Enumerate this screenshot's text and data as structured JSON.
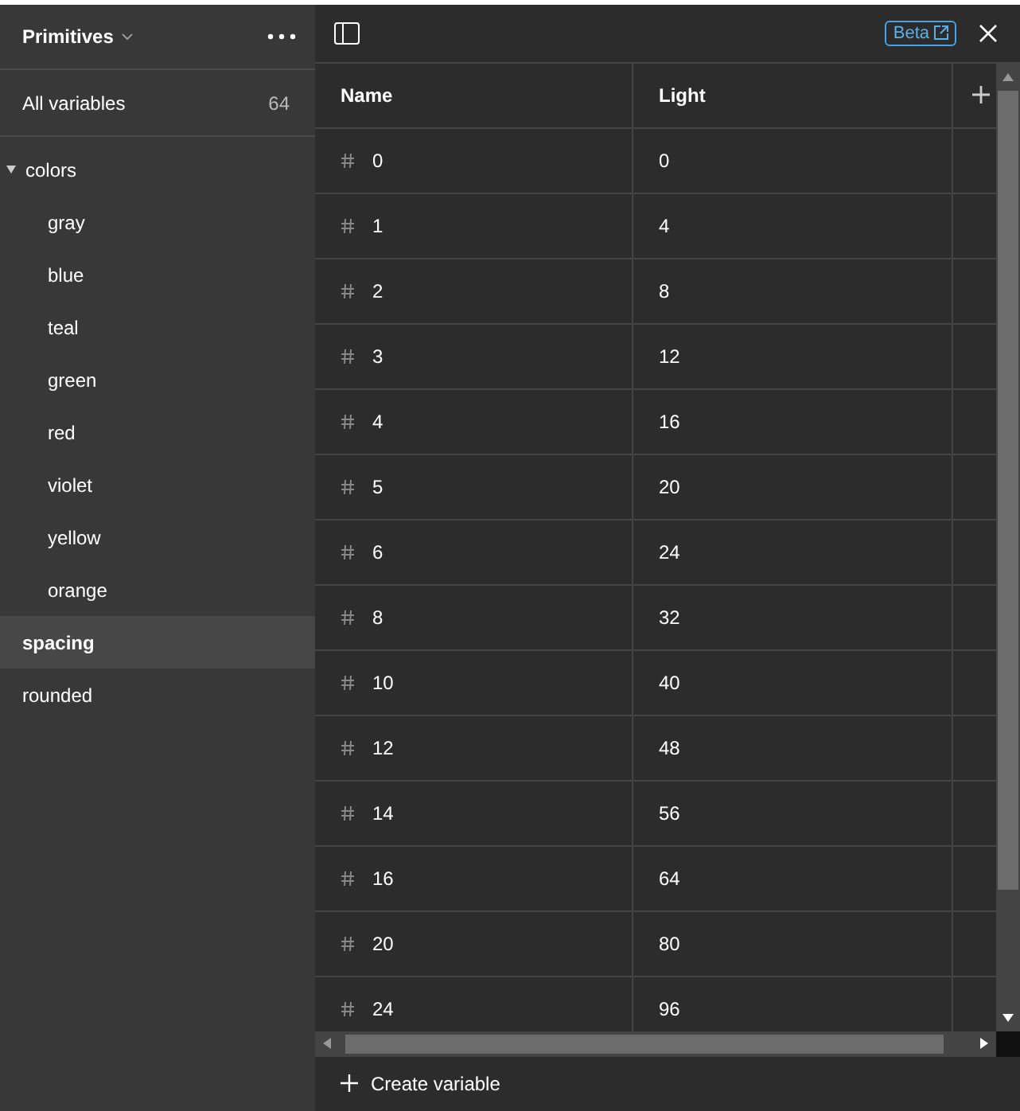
{
  "sidebar": {
    "collection": "Primitives",
    "all_variables": {
      "label": "All variables",
      "count": "64"
    },
    "groups": [
      {
        "label": "colors",
        "expanded": true,
        "selected": false,
        "children": [
          {
            "label": "gray",
            "selected": false
          },
          {
            "label": "blue",
            "selected": false
          },
          {
            "label": "teal",
            "selected": false
          },
          {
            "label": "green",
            "selected": false
          },
          {
            "label": "red",
            "selected": false
          },
          {
            "label": "violet",
            "selected": false
          },
          {
            "label": "yellow",
            "selected": false
          },
          {
            "label": "orange",
            "selected": false
          }
        ]
      },
      {
        "label": "spacing",
        "selected": true
      },
      {
        "label": "rounded",
        "selected": false
      }
    ]
  },
  "toolbar": {
    "badge": "Beta"
  },
  "table": {
    "columns": [
      "Name",
      "Light"
    ],
    "rows": [
      {
        "name": "0",
        "light": "0"
      },
      {
        "name": "1",
        "light": "4"
      },
      {
        "name": "2",
        "light": "8"
      },
      {
        "name": "3",
        "light": "12"
      },
      {
        "name": "4",
        "light": "16"
      },
      {
        "name": "5",
        "light": "20"
      },
      {
        "name": "6",
        "light": "24"
      },
      {
        "name": "8",
        "light": "32"
      },
      {
        "name": "10",
        "light": "40"
      },
      {
        "name": "12",
        "light": "48"
      },
      {
        "name": "14",
        "light": "56"
      },
      {
        "name": "16",
        "light": "64"
      },
      {
        "name": "20",
        "light": "80"
      },
      {
        "name": "24",
        "light": "96"
      }
    ]
  },
  "footer": {
    "create": "Create variable"
  }
}
